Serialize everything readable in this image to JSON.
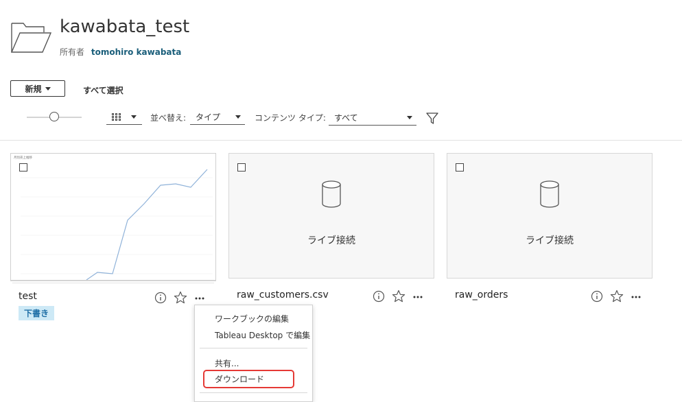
{
  "header": {
    "title": "kawabata_test",
    "owner_label": "所有者",
    "owner_name": "tomohiro kawabata"
  },
  "toolbar": {
    "new_label": "新規",
    "select_all_label": "すべて選択"
  },
  "filters": {
    "sort_label": "並べ替え:",
    "sort_value": "タイプ",
    "content_type_label": "コンテンツ タイプ:",
    "content_type_value": "すべて"
  },
  "items": [
    {
      "name": "test",
      "badge": "下書き",
      "kind": "workbook",
      "thumb_title": "月別売上推移"
    },
    {
      "name": "raw_customers.csv",
      "kind": "datasource",
      "card_label": "ライブ接続"
    },
    {
      "name": "raw_orders",
      "kind": "datasource",
      "card_label": "ライブ接続"
    }
  ],
  "context_menu": {
    "items": [
      "ワークブックの編集",
      "Tableau Desktop で編集",
      "共有...",
      "ダウンロード"
    ]
  },
  "colors": {
    "accent": "#1a5e7a",
    "badge_bg": "#cde9f6",
    "highlight": "#e53935",
    "line": "#8fb2d9"
  }
}
